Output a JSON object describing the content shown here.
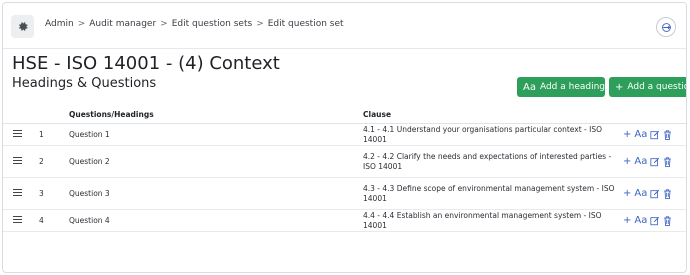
{
  "breadcrumb": [
    "Admin",
    "Audit manager",
    "Edit question sets",
    "Edit question set"
  ],
  "page_title": "HSE - ISO 14001 - (4) Context",
  "section_title": "Headings & Questions",
  "buttons": {
    "add_heading": "Add a heading",
    "add_heading_icon": "Aa",
    "add_question": "Add a question",
    "add_question_icon": "+"
  },
  "table": {
    "headers": [
      "Questions/Headings",
      "Clause"
    ],
    "rows": [
      {
        "num": "1",
        "question": "Question 1",
        "clause": "4.1 - 4.1 Understand your organisations particular context - ISO 14001"
      },
      {
        "num": "2",
        "question": "Question 2",
        "clause": "4.2 - 4.2 Clarify the needs and expectations of interested parties - ISO 14001"
      },
      {
        "num": "3",
        "question": "Question 3",
        "clause": "4.3 - 4.3 Define scope of environmental management system - ISO 14001"
      },
      {
        "num": "4",
        "question": "Question 4",
        "clause": "4.4 - 4.4 Establish an environmental management system - ISO 14001"
      }
    ],
    "action_labels": {
      "add": "+",
      "heading": "Aa"
    }
  },
  "colors": {
    "accent_green": "#2e9e5b",
    "action_blue": "#3e63c7"
  }
}
